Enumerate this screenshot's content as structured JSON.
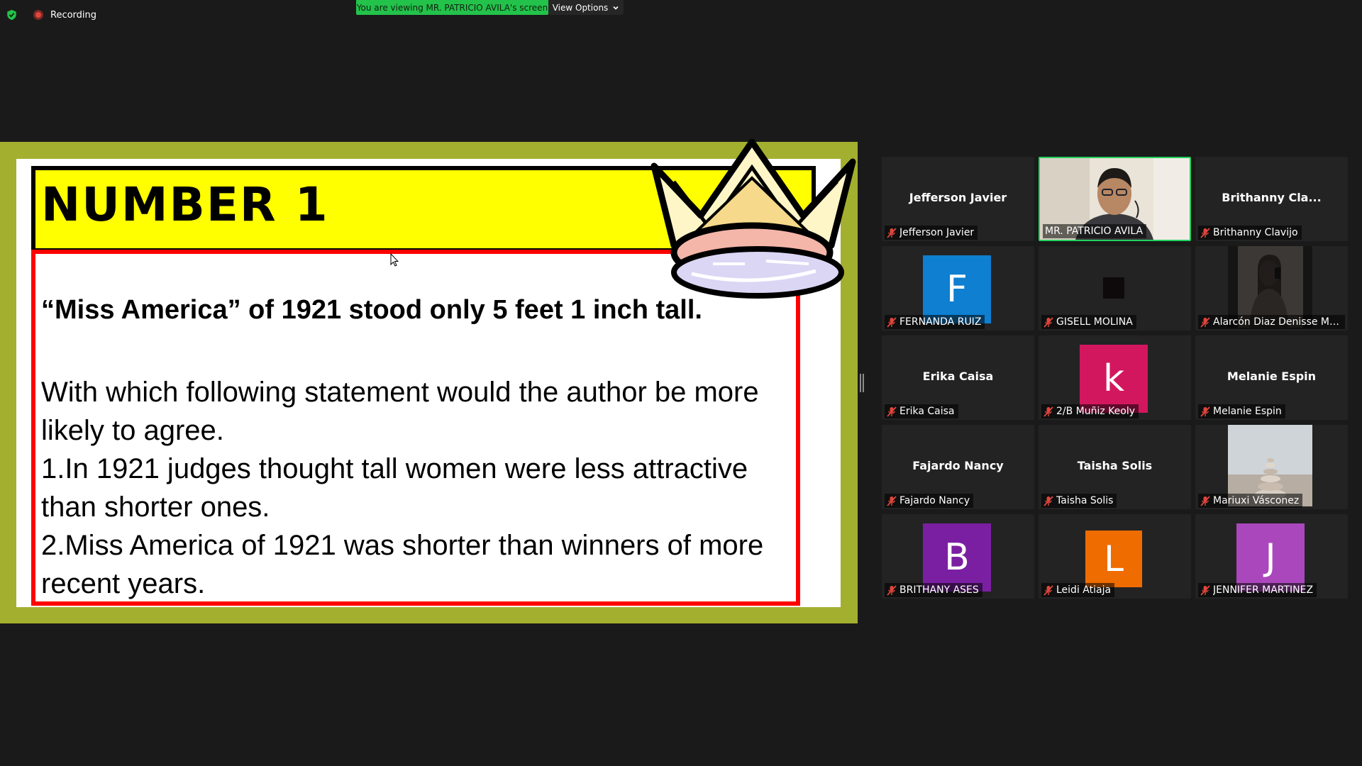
{
  "top_bar": {
    "recording_label": "Recording",
    "viewing_banner": "You are viewing MR. PATRICIO AVILA's screen",
    "view_options_label": "View Options"
  },
  "slide": {
    "title": "NUMBER 1",
    "fact": "“Miss America” of 1921 stood only 5 feet 1 inch tall.",
    "question_lines": [
      "With which following statement would the author be more likely to agree.",
      "1.In 1921 judges thought tall women were less attractive than shorter ones.",
      "2.Miss America of 1921 was shorter than winners of more recent years."
    ]
  },
  "participants": [
    {
      "center_name": "Jefferson Javier",
      "label": "Jefferson Javier"
    },
    {
      "center_name": "",
      "label": "MR. PATRICIO AVILA"
    },
    {
      "center_name": "Brithanny Cla...",
      "label": "Brithanny Clavijo"
    },
    {
      "avatar_letter": "F",
      "avatar_color": "#0e7fd1",
      "label": "FERNANDA RUIZ"
    },
    {
      "center_name": "",
      "label": "GISELL MOLINA"
    },
    {
      "center_name": "",
      "label": "Alarcón Diaz Denisse Mi..."
    },
    {
      "center_name": "Erika Caisa",
      "label": "Erika Caisa"
    },
    {
      "avatar_letter": "k",
      "avatar_color": "#d3175f",
      "label": "2/B Muñiz Keoly"
    },
    {
      "center_name": "Melanie Espin",
      "label": "Melanie Espin"
    },
    {
      "center_name": "Fajardo Nancy",
      "label": "Fajardo Nancy"
    },
    {
      "center_name": "Taisha Solis",
      "label": "Taisha Solis"
    },
    {
      "center_name": "",
      "label": "Mariuxi Vásconez"
    },
    {
      "avatar_letter": "B",
      "avatar_color": "#7b1fa2",
      "label": "BRITHANY ASES"
    },
    {
      "avatar_letter": "L",
      "avatar_color": "#ef6c00",
      "label": "Leidi Atiaja"
    },
    {
      "avatar_letter": "J",
      "avatar_color": "#ab47bc",
      "label": "JENNIFER MARTINEZ"
    }
  ],
  "colors": {
    "active_speaker_border": "#23d160",
    "banner_green": "#23c24b",
    "slide_frame": "#a3b02f",
    "title_fill": "#ffff00",
    "content_border": "#ff0000"
  }
}
